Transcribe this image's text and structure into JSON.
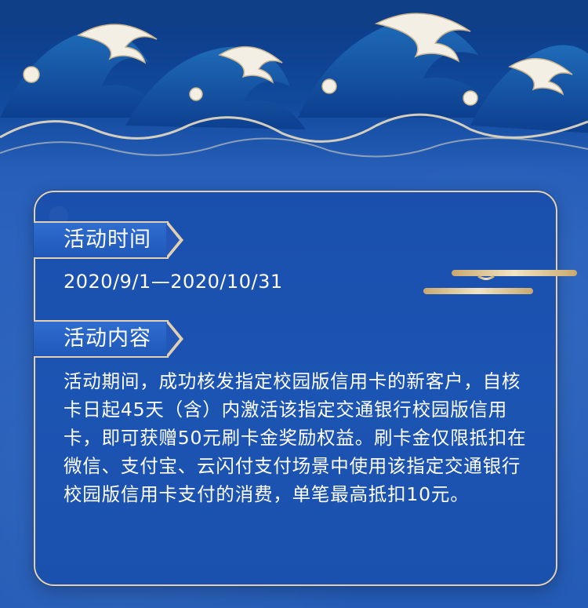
{
  "section_time": {
    "heading": "活动时间",
    "value": "2020/9/1—2020/10/31"
  },
  "section_content": {
    "heading": "活动内容",
    "paragraph": "活动期间，成功核发指定校园版信用卡的新客户，自核卡日起45天（含）内激活该指定交通银行校园版信用卡，即可获赠50元刷卡金奖励权益。刷卡金仅限抵扣在微信、支付宝、云闪付支付场景中使用该指定交通银行校园版信用卡支付的消费，单笔最高抵扣10元。"
  },
  "colors": {
    "background": "#2358b4",
    "card_border": "#e3d0b0",
    "gold": "#d9c29a"
  },
  "decoration": {
    "banner_icon": "ocean-waves-icon",
    "ornament_icon": "gold-cloud-line-icon"
  }
}
